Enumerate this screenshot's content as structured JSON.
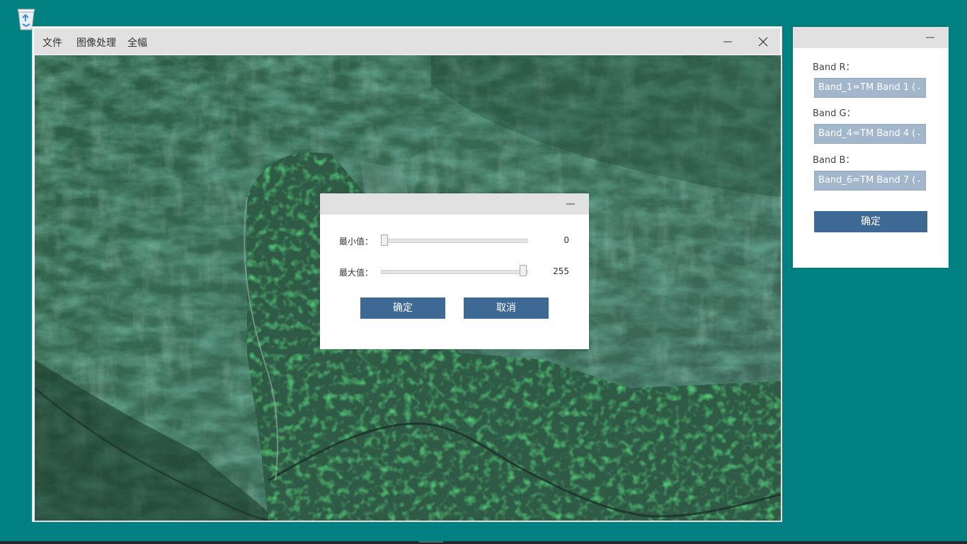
{
  "main_window": {
    "menu": [
      "文件",
      "图像处理",
      "全幅"
    ]
  },
  "stretch_dialog": {
    "min_label": "最小值：",
    "max_label": "最大值：",
    "min_value": "0",
    "max_value": "255",
    "min_slider_fraction": 0.0,
    "max_slider_fraction": 1.0,
    "ok_label": "确定",
    "cancel_label": "取消"
  },
  "band_panel": {
    "band_r_label": "Band R：",
    "band_r_value": "Band_1=TM Band 1 (",
    "band_g_label": "Band G：",
    "band_g_value": "Band_4=TM Band 4 (",
    "band_b_label": "Band B：",
    "band_b_value": "Band_6=TM Band 7 (",
    "ok_label": "确定"
  },
  "colors": {
    "desktop": "#008080",
    "button_blue": "#3e6994",
    "select_blue": "#a3b7cc",
    "titlebar_gray": "#e1e1e1"
  },
  "icons": [
    "recycle-bin-icon",
    "minimize-icon",
    "close-icon",
    "chevron-down-icon"
  ]
}
